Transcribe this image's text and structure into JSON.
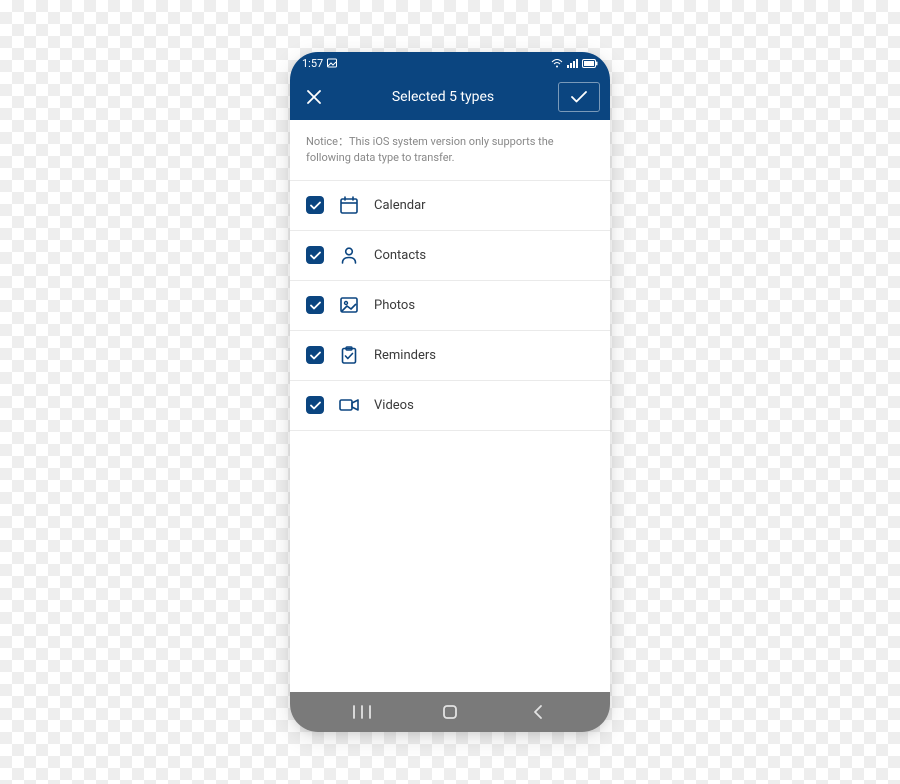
{
  "status": {
    "time": "1:57"
  },
  "header": {
    "title": "Selected 5 types"
  },
  "notice": "Notice：This iOS system version only supports the following data type to transfer.",
  "items": [
    {
      "label": "Calendar",
      "icon": "calendar-icon",
      "checked": true
    },
    {
      "label": "Contacts",
      "icon": "contacts-icon",
      "checked": true
    },
    {
      "label": "Photos",
      "icon": "photos-icon",
      "checked": true
    },
    {
      "label": "Reminders",
      "icon": "reminders-icon",
      "checked": true
    },
    {
      "label": "Videos",
      "icon": "videos-icon",
      "checked": true
    }
  ],
  "colors": {
    "primary": "#0b4580"
  }
}
